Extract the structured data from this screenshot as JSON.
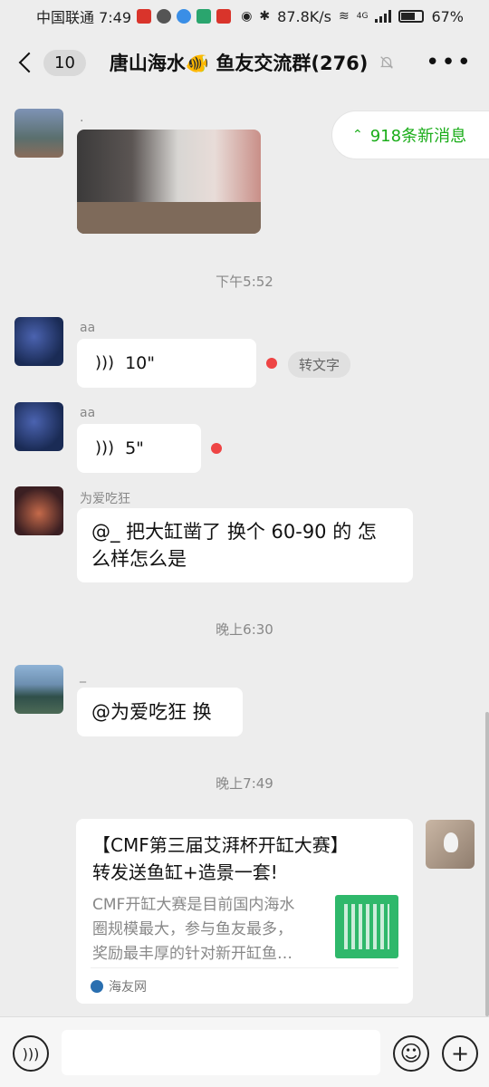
{
  "status": {
    "carrier_time": "中国联通 7:49",
    "speed": "87.8K/s",
    "network": "4G",
    "battery": "67%"
  },
  "header": {
    "unread_count": "10",
    "title": "唐山海水🐠 鱼友交流群(276)"
  },
  "new_messages": "918条新消息",
  "messages": {
    "m1": {
      "sender": "."
    },
    "t1": "下午5:52",
    "m2": {
      "sender": "aa",
      "duration": "10\"",
      "to_text": "转文字"
    },
    "m3": {
      "sender": "aa",
      "duration": "5\""
    },
    "m4": {
      "sender": "为爱吃狂",
      "text_line1": "@_ 把大缸凿了 换个 60-90 的 怎",
      "text_line2": "么样怎么是"
    },
    "t2": "晚上6:30",
    "m5": {
      "sender": "_",
      "text": "@为爱吃狂  换"
    },
    "t3": "晚上7:49",
    "card": {
      "title_line1": "【CMF第三届艾湃杯开缸大赛】",
      "title_line2": "转发送鱼缸+造景一套!",
      "desc_line1": "CMF开缸大赛是目前国内海水",
      "desc_line2": "圈规模最大，参与鱼友最多，",
      "desc_line3": "奖励最丰厚的针对新开缸鱼…",
      "source": "海友网"
    }
  },
  "colors": {
    "accent": "#1aad19",
    "bubble": "#ffffff",
    "bg": "#ededed",
    "unread_dot": "#ee4444"
  }
}
